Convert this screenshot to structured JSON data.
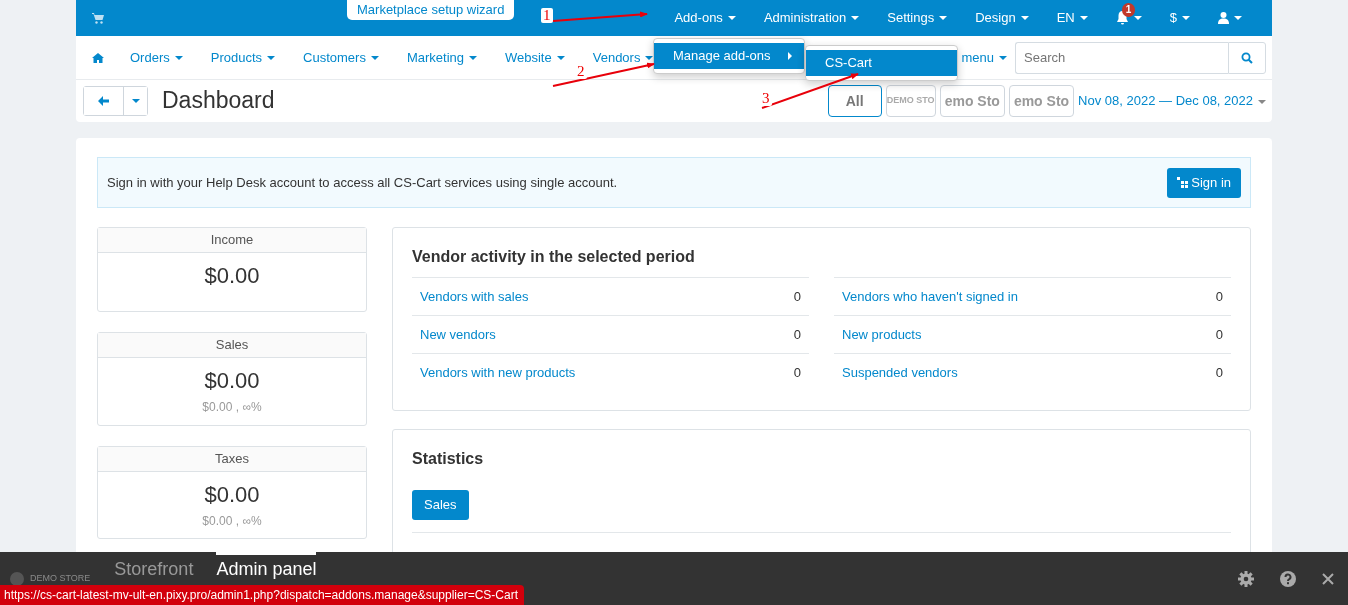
{
  "topbar": {
    "wizard_button": "Marketplace setup wizard",
    "menus": [
      {
        "kind": "text",
        "label": "Add-ons"
      },
      {
        "kind": "text",
        "label": "Administration"
      },
      {
        "kind": "text",
        "label": "Settings"
      },
      {
        "kind": "text",
        "label": "Design"
      },
      {
        "kind": "text",
        "label": "EN"
      },
      {
        "kind": "bell",
        "badge": "1"
      },
      {
        "kind": "text",
        "label": "$"
      },
      {
        "kind": "user"
      }
    ]
  },
  "addons_menu": {
    "items": [
      {
        "label": "Manage add-ons",
        "selected": true
      }
    ]
  },
  "addons_submenu": {
    "items": [
      {
        "label": "CS-Cart",
        "selected": true
      }
    ]
  },
  "nav": {
    "items": [
      "Orders",
      "Products",
      "Customers",
      "Marketing",
      "Website",
      "Vendors"
    ],
    "partial_item": "menu",
    "search": {
      "placeholder": "Search"
    }
  },
  "page": {
    "title": "Dashboard",
    "storefronts": [
      {
        "kind": "all",
        "label": "All",
        "selected": true
      },
      {
        "kind": "small",
        "label": "DEMO STO",
        "selected": false
      },
      {
        "kind": "bold",
        "label": "emo Sto",
        "selected": false
      },
      {
        "kind": "bold",
        "label": "emo Sto",
        "selected": false
      }
    ],
    "date_range": "Nov 08, 2022 — Dec 08, 2022"
  },
  "helpdesk_notice": {
    "text": "Sign in with your Help Desk account to access all CS-Cart services using single account.",
    "button": "Sign in"
  },
  "stats": [
    {
      "title": "Income",
      "value": "$0.00"
    },
    {
      "title": "Sales",
      "value": "$0.00",
      "change": "$0.00 , ∞%"
    },
    {
      "title": "Taxes",
      "value": "$0.00",
      "change": "$0.00 , ∞%"
    }
  ],
  "vendor_activity": {
    "title": "Vendor activity in the selected period",
    "columns": [
      [
        {
          "label": "Vendors with sales",
          "count": "0"
        },
        {
          "label": "New vendors",
          "count": "0"
        },
        {
          "label": "Vendors with new products",
          "count": "0"
        }
      ],
      [
        {
          "label": "Vendors who haven't signed in",
          "count": "0"
        },
        {
          "label": "New products",
          "count": "0"
        },
        {
          "label": "Suspended vendors",
          "count": "0"
        }
      ]
    ]
  },
  "statistics": {
    "title": "Statistics",
    "tabs": [
      {
        "label": "Sales",
        "selected": true
      }
    ]
  },
  "bottom_panel": {
    "brand": "DEMO STORE",
    "tabs": [
      {
        "label": "Storefront",
        "selected": false
      },
      {
        "label": "Admin panel",
        "selected": true
      }
    ]
  },
  "status_url": "https://cs-cart-latest-mv-ult-en.pixy.pro/admin1.php?dispatch=addons.manage&supplier=CS-Cart",
  "annotations": [
    {
      "label": "1"
    },
    {
      "label": "2"
    },
    {
      "label": "3"
    }
  ]
}
